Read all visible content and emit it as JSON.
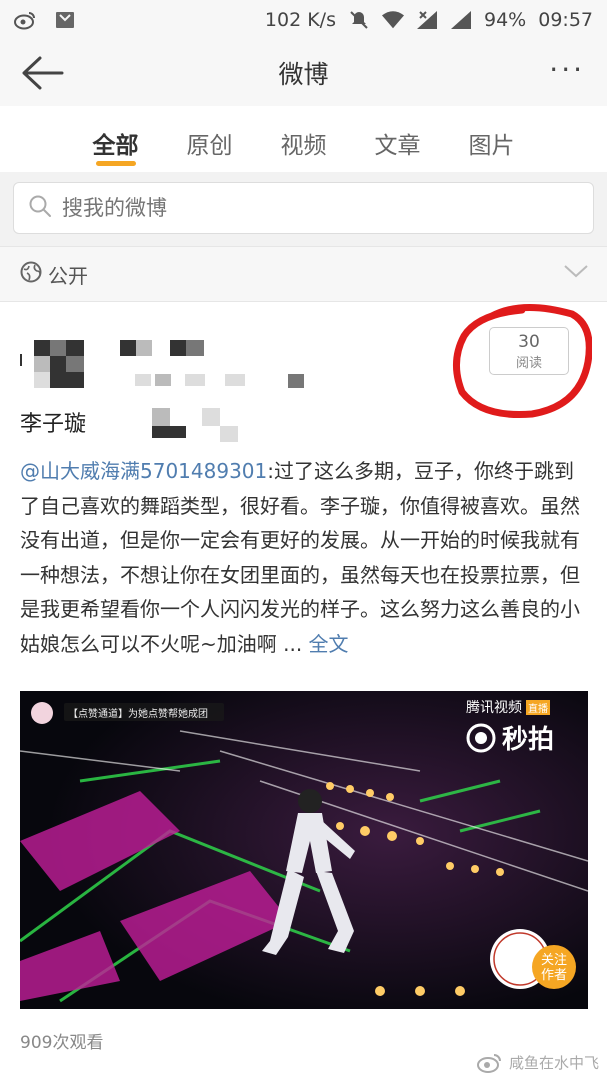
{
  "status_bar": {
    "speed": "102 K/s",
    "battery": "94%",
    "time": "09:57"
  },
  "nav": {
    "title": "微博"
  },
  "tabs": [
    "全部",
    "原创",
    "视频",
    "文章",
    "图片"
  ],
  "search": {
    "placeholder": "搜我的微博"
  },
  "privacy": {
    "label": "公开"
  },
  "post": {
    "author": "李子璇",
    "read_count": "30",
    "read_label": "阅读",
    "mention": "@山大威海满5701489301",
    "text": ":过了这么多期，豆子，你终于跳到了自己喜欢的舞蹈类型，很好看。李子璇，你值得被喜欢。虽然没有出道，但是你一定会有更好的发展。从一开始的时候我就有一种想法，不想让你在女团里面的，虽然每天也在投票拉票，但是我更希望看你一个人闪闪发光的样子。这么努力这么善良的小姑娘怎么可以不火呢~加油啊 ... ",
    "full_text_link": "全文",
    "video": {
      "banner": "【点赞通道】为她点赞帮她成团",
      "brand_top": "腾讯视频",
      "brand_tag": "直播",
      "brand_bottom": "秒拍",
      "follow_label": "关注作者"
    },
    "views": "909次观看"
  },
  "watermark": "咸鱼在水中飞"
}
